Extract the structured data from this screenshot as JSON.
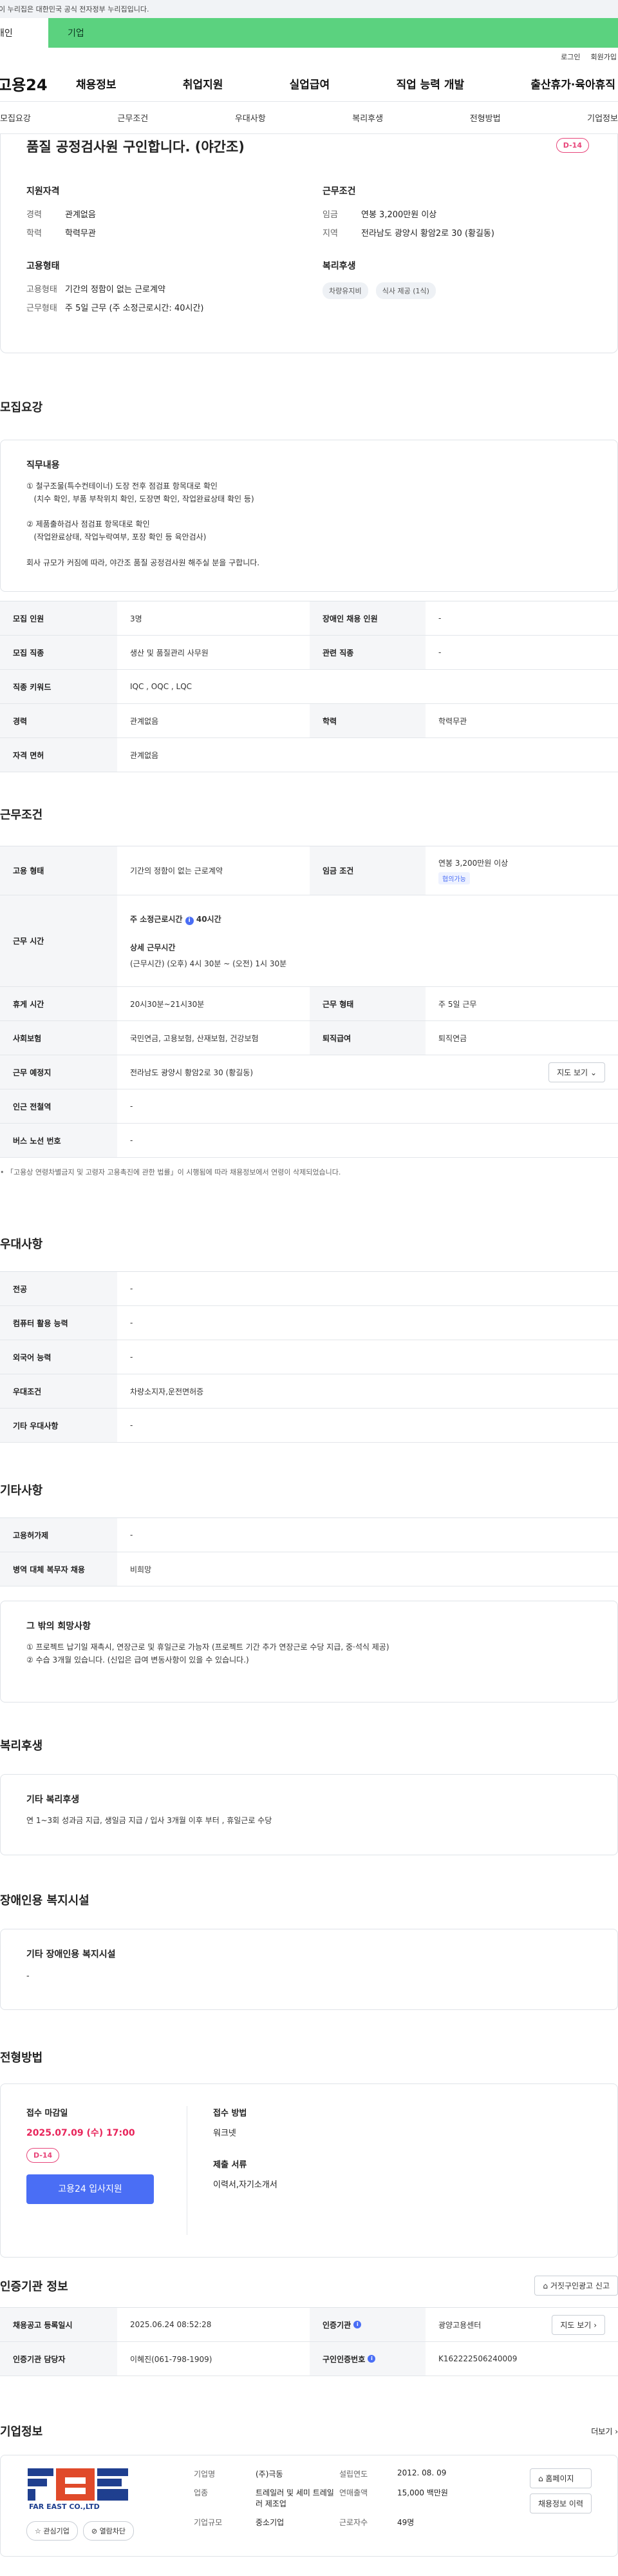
{
  "gov_banner": "이 누리집은 대한민국 공식 전자정부 누리집입니다.",
  "audience_tabs": {
    "individual": "개인",
    "business": "기업"
  },
  "util": {
    "login": "로그인",
    "join": "회원가입"
  },
  "logo": "고용24",
  "gnb": [
    "채용정보",
    "취업지원",
    "실업급여",
    "직업 능력 개발",
    "출산휴가·육아휴직"
  ],
  "sub_tabs": [
    "모집요강",
    "근무조건",
    "우대사항",
    "복리후생",
    "전형방법",
    "기업정보"
  ],
  "summary": {
    "title": "품질 공정검사원 구인합니다. (야간조)",
    "dday": "D-14",
    "qual_title": "지원자격",
    "career_k": "경력",
    "career_v": "관계없음",
    "edu_k": "학력",
    "edu_v": "학력무관",
    "employ_title": "고용형태",
    "emp_type_k": "고용형태",
    "emp_type_v": "기간의 정함이 없는 근로계약",
    "work_type_k": "근무형태",
    "work_type_v": "주 5일 근무 (주 소정근로시간: 40시간)",
    "cond_title": "근무조건",
    "wage_k": "임금",
    "wage_v": "연봉 3,200만원 이상",
    "region_k": "지역",
    "region_v": "전라남도 광양시 황암2로 30 (황길동)",
    "welfare_title": "복리후생",
    "chips": [
      "차량유지비",
      "식사 제공 (1식)"
    ]
  },
  "recruit": {
    "section_title": "모집요강",
    "duty_title": "직무내용",
    "duty_lines": [
      "① 철구조물(특수컨테이너) 도장 전후 점검표 항목대로 확인",
      "   (치수 확인, 부품 부착위치 확인, 도장면 확인, 작업완료상태 확인 등)",
      "",
      "② 제품출하검사 점검표 항목대로 확인",
      "   (작업완료상태, 작업누락여부, 포장 확인 등 육안검사)",
      "",
      "회사 규모가 커짐에 따라, 야간조 품질 공정검사원 해주실 분을 구합니다."
    ],
    "headcount_k": "모집 인원",
    "headcount_v": "3명",
    "disabled_k": "장애인 채용 인원",
    "disabled_v": "-",
    "job_k": "모집 직종",
    "job_v": "생산 및 품질관리 사무원",
    "related_k": "관련 직종",
    "related_v": "-",
    "keyword_k": "직종 키워드",
    "keyword_v": "IQC , OQC , LQC",
    "career_k": "경력",
    "career_v": "관계없음",
    "edu_k": "학력",
    "edu_v": "학력무관",
    "license_k": "자격 면허",
    "license_v": "관계없음"
  },
  "conditions": {
    "section_title": "근무조건",
    "emp_k": "고용 형태",
    "emp_v": "기간의 정함이 없는 근로계약",
    "wage_k": "임금 조건",
    "wage_v": "연봉 3,200만원 이상",
    "wage_badge": "협의가능",
    "hours_k": "근무 시간",
    "hours_main": "주 소정근로시간",
    "hours_main_v": "40시간",
    "hours_detail_title": "상세 근무시간",
    "hours_detail_v": "(근무시간) (오후) 4시 30분 ~ (오전) 1시 30분",
    "rest_k": "휴게 시간",
    "rest_v": "20시30분~21시30분",
    "shift_k": "근무 형태",
    "shift_v": "주 5일 근무",
    "insurance_k": "사회보험",
    "insurance_v": "국민연금, 고용보험, 산재보험, 건강보험",
    "severance_k": "퇴직급여",
    "severance_v": "퇴직연금",
    "place_k": "근무 예정지",
    "place_v": "전라남도 광양시 황암2로 30 (황길동)",
    "map_btn": "지도 보기",
    "station_k": "인근 전철역",
    "station_v": "-",
    "bus_k": "버스 노선 번호",
    "bus_v": "-",
    "note": "「고용상 연령차별금지 및 고령자 고용촉진에 관한 법률」이 시행됨에 따라 채용정보에서 연령이 삭제되었습니다."
  },
  "preference": {
    "section_title": "우대사항",
    "major_k": "전공",
    "major_v": "-",
    "computer_k": "컴퓨터 활용 능력",
    "computer_v": "-",
    "lang_k": "외국어 능력",
    "lang_v": "-",
    "pref_k": "우대조건",
    "pref_v": "차량소지자,운전면허증",
    "etc_k": "기타 우대사항",
    "etc_v": "-"
  },
  "etc": {
    "section_title": "기타사항",
    "foreign_k": "고용허가제",
    "foreign_v": "-",
    "military_k": "병역 대체 복무자 채용",
    "military_v": "비희망",
    "wish_title": "그 밖의 희망사항",
    "wish_lines": [
      "① 프로젝트 납기일 재촉시, 연장근로 및 휴일근로 가능자 (프로젝트 기간 추가 연장근로 수당 지급, 중·석식 제공)",
      "② 수습 3개월 있습니다. (신입은 급여 변동사항이 있을 수 있습니다.)"
    ]
  },
  "welfare": {
    "section_title": "복리후생",
    "etc_title": "기타 복리후생",
    "etc_v": "연 1~3회 성과금 지급, 생일금 지급 / 입사 3개월 이후 부터 , 휴일근로 수당"
  },
  "disability": {
    "section_title": "장애인용 복지시설",
    "title": "기타 장애인용 복지시설",
    "value": "-"
  },
  "apply": {
    "section_title": "전형방법",
    "deadline_k": "접수 마감일",
    "deadline_v": "2025.07.09 (수) 17:00",
    "dday": "D-14",
    "apply_btn": "고용24 입사지원",
    "method_k": "접수 방법",
    "method_v": "워크넷",
    "docs_k": "제출 서류",
    "docs_v": "이력서,자기소개서"
  },
  "cert": {
    "section_title": "인증기관 정보",
    "report_btn": "거짓구인광고 신고",
    "reg_k": "채용공고 등록일시",
    "reg_v": "2025.06.24 08:52:28",
    "agency_k": "인증기관",
    "agency_v": "광양고용센터",
    "map_btn": "지도 보기",
    "manager_k": "인증기관 담당자",
    "manager_v": "이혜진(061-798-1909)",
    "auth_no_k": "구인인증번호",
    "auth_no_v": "K162222506240009"
  },
  "company": {
    "section_title": "기업정보",
    "more": "더보기",
    "logo_text": "FAR EAST CO.,LTD",
    "name_k": "기업명",
    "name_v": "(주)극동",
    "industry_k": "업종",
    "industry_v": "트레일러 및 세미 트레일러 제조업",
    "size_k": "기업규모",
    "size_v": "중소기업",
    "founded_k": "설립연도",
    "founded_v": "2012. 08. 09",
    "sales_k": "연매출액",
    "sales_v": "15,000 백만원",
    "staff_k": "근로자수",
    "staff_v": "49명",
    "homepage_btn": "홈페이지",
    "jobs_btn": "채용정보 이력",
    "fav_btn": "관심기업",
    "block_btn": "열람차단"
  },
  "colors": {
    "accent": "#4a6ef5",
    "biz_tab": "#5bd27f",
    "dday": "#e8457a"
  }
}
